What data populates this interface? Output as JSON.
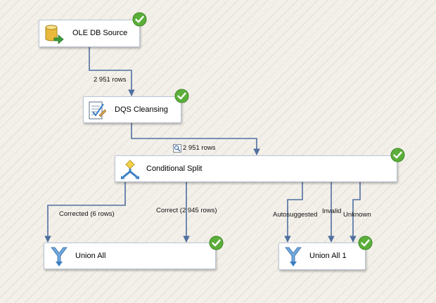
{
  "components": {
    "ole_db_source": {
      "label": "OLE DB Source",
      "icon": "database-source-icon",
      "status": "success"
    },
    "dqs_cleansing": {
      "label": "DQS Cleansing",
      "icon": "dqs-cleansing-icon",
      "status": "success"
    },
    "conditional_split": {
      "label": "Conditional Split",
      "icon": "conditional-split-icon",
      "status": "success"
    },
    "union_all": {
      "label": "Union All",
      "icon": "union-all-icon",
      "status": "success"
    },
    "union_all_1": {
      "label": "Union All 1",
      "icon": "union-all-icon",
      "status": "success"
    }
  },
  "paths": {
    "source_to_dqs": "2 951 rows",
    "dqs_to_split": "2 951 rows",
    "corrected": "Corrected (6 rows)",
    "correct": "Correct (2 945 rows)",
    "autosuggested": "Autosuggested",
    "invalid": "Invalid",
    "unknown": "Unknown"
  },
  "colors": {
    "path_line": "#4f6f9f",
    "success_green": "#5cae3a",
    "box_border": "#bdc7d6",
    "canvas_bg": "#f3f0ea"
  }
}
